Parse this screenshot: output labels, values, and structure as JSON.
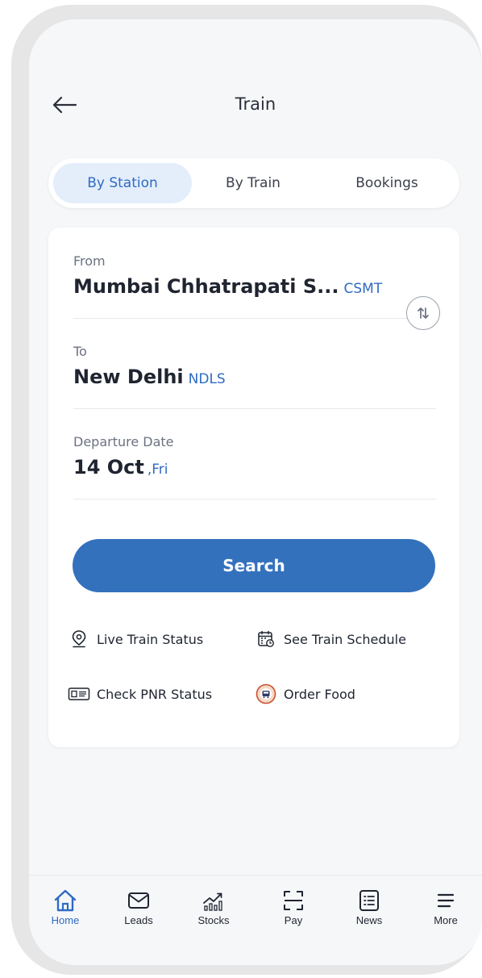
{
  "header": {
    "title": "Train"
  },
  "tabs": [
    {
      "label": "By Station",
      "active": true
    },
    {
      "label": "By Train",
      "active": false
    },
    {
      "label": "Bookings",
      "active": false
    }
  ],
  "form": {
    "from": {
      "label": "From",
      "station": "Mumbai Chhatrapati S...",
      "code": "CSMT"
    },
    "to": {
      "label": "To",
      "station": "New Delhi",
      "code": "NDLS"
    },
    "date": {
      "label": "Departure Date",
      "value": "14 Oct",
      "day": ",Fri"
    },
    "search_label": "Search"
  },
  "quick_links": [
    {
      "label": "Live Train Status",
      "icon": "location-pin-icon"
    },
    {
      "label": "See Train Schedule",
      "icon": "calendar-clock-icon"
    },
    {
      "label": "Check PNR Status",
      "icon": "ticket-icon"
    },
    {
      "label": "Order Food",
      "icon": "food-icon"
    }
  ],
  "nav": [
    {
      "label": "Home",
      "icon": "home-icon",
      "active": true
    },
    {
      "label": "Leads",
      "icon": "mail-icon",
      "active": false
    },
    {
      "label": "Stocks",
      "icon": "stocks-chart-icon",
      "active": false
    },
    {
      "label": "Pay",
      "icon": "scan-icon",
      "active": false
    },
    {
      "label": "News",
      "icon": "news-icon",
      "active": false
    },
    {
      "label": "More",
      "icon": "menu-icon",
      "active": false
    }
  ],
  "colors": {
    "accent": "#3471bd",
    "accent_text": "#2f6bc3",
    "active_tab_bg": "#e4eefb",
    "screen_bg": "#f6f7f9",
    "card_bg": "#ffffff"
  }
}
